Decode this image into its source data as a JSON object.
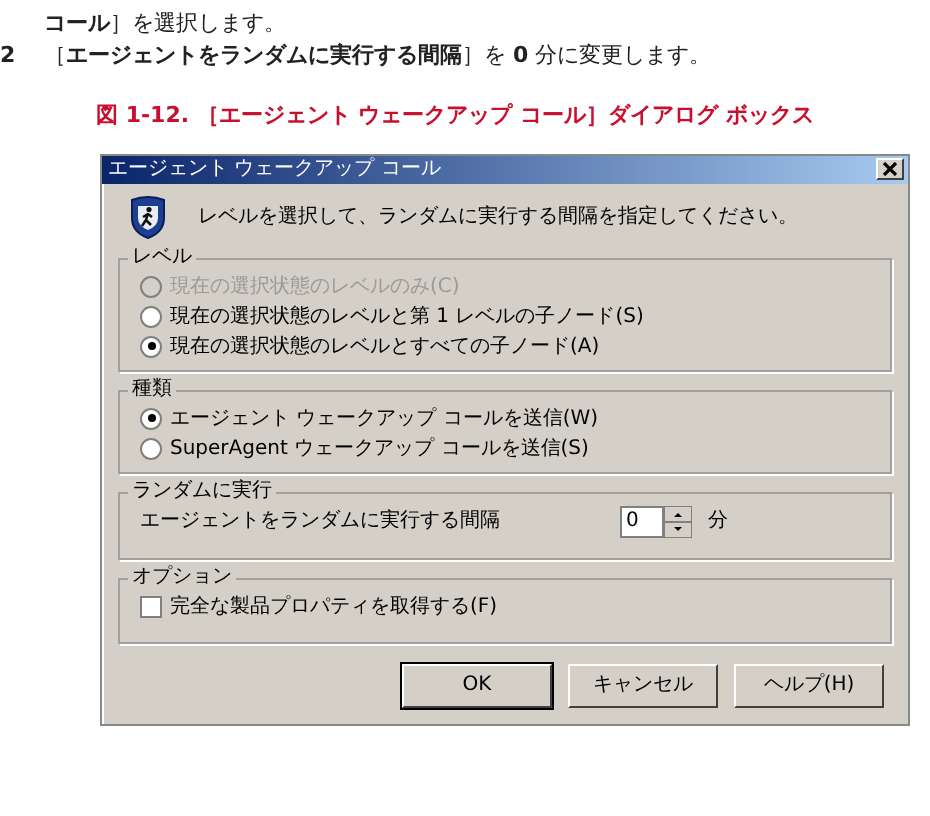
{
  "document": {
    "lines": [
      {
        "text": "**コール**］を選択します。"
      },
      {
        "number": "2",
        "text": "［**エージェントをランダムに実行する間隔**］を **0** 分に変更します。"
      }
    ],
    "caption": "図 1-12. ［エージェント ウェークアップ コール］ダイアログ ボックス"
  },
  "dialog": {
    "title": "エージェント ウェークアップ コール",
    "message": "レベルを選択して、ランダムに実行する間隔を指定してください。",
    "groups": [
      {
        "kind": "radios",
        "label": "レベル",
        "options": [
          {
            "label": "現在の選択状態のレベルのみ(C)",
            "selected": false,
            "disabled": true
          },
          {
            "label": "現在の選択状態のレベルと第 1 レベルの子ノード(S)",
            "selected": false,
            "disabled": false
          },
          {
            "label": "現在の選択状態のレベルとすべての子ノード(A)",
            "selected": true,
            "disabled": false
          }
        ]
      },
      {
        "kind": "radios",
        "label": "種類",
        "options": [
          {
            "label": "エージェント ウェークアップ コールを送信(W)",
            "selected": true,
            "disabled": false
          },
          {
            "label": "SuperAgent ウェークアップ コールを送信(S)",
            "selected": false,
            "disabled": false
          }
        ]
      },
      {
        "kind": "spinner",
        "label": "ランダムに実行",
        "field_label": "エージェントをランダムに実行する間隔",
        "value": "0",
        "unit": "分"
      },
      {
        "kind": "checkbox",
        "label": "オプション",
        "option": {
          "label": "完全な製品プロパティを取得する(F)",
          "checked": false
        }
      }
    ],
    "buttons": [
      {
        "label": "OK",
        "default": true
      },
      {
        "label": "キャンセル",
        "default": false
      },
      {
        "label": "ヘルプ(H)",
        "default": false
      }
    ]
  }
}
